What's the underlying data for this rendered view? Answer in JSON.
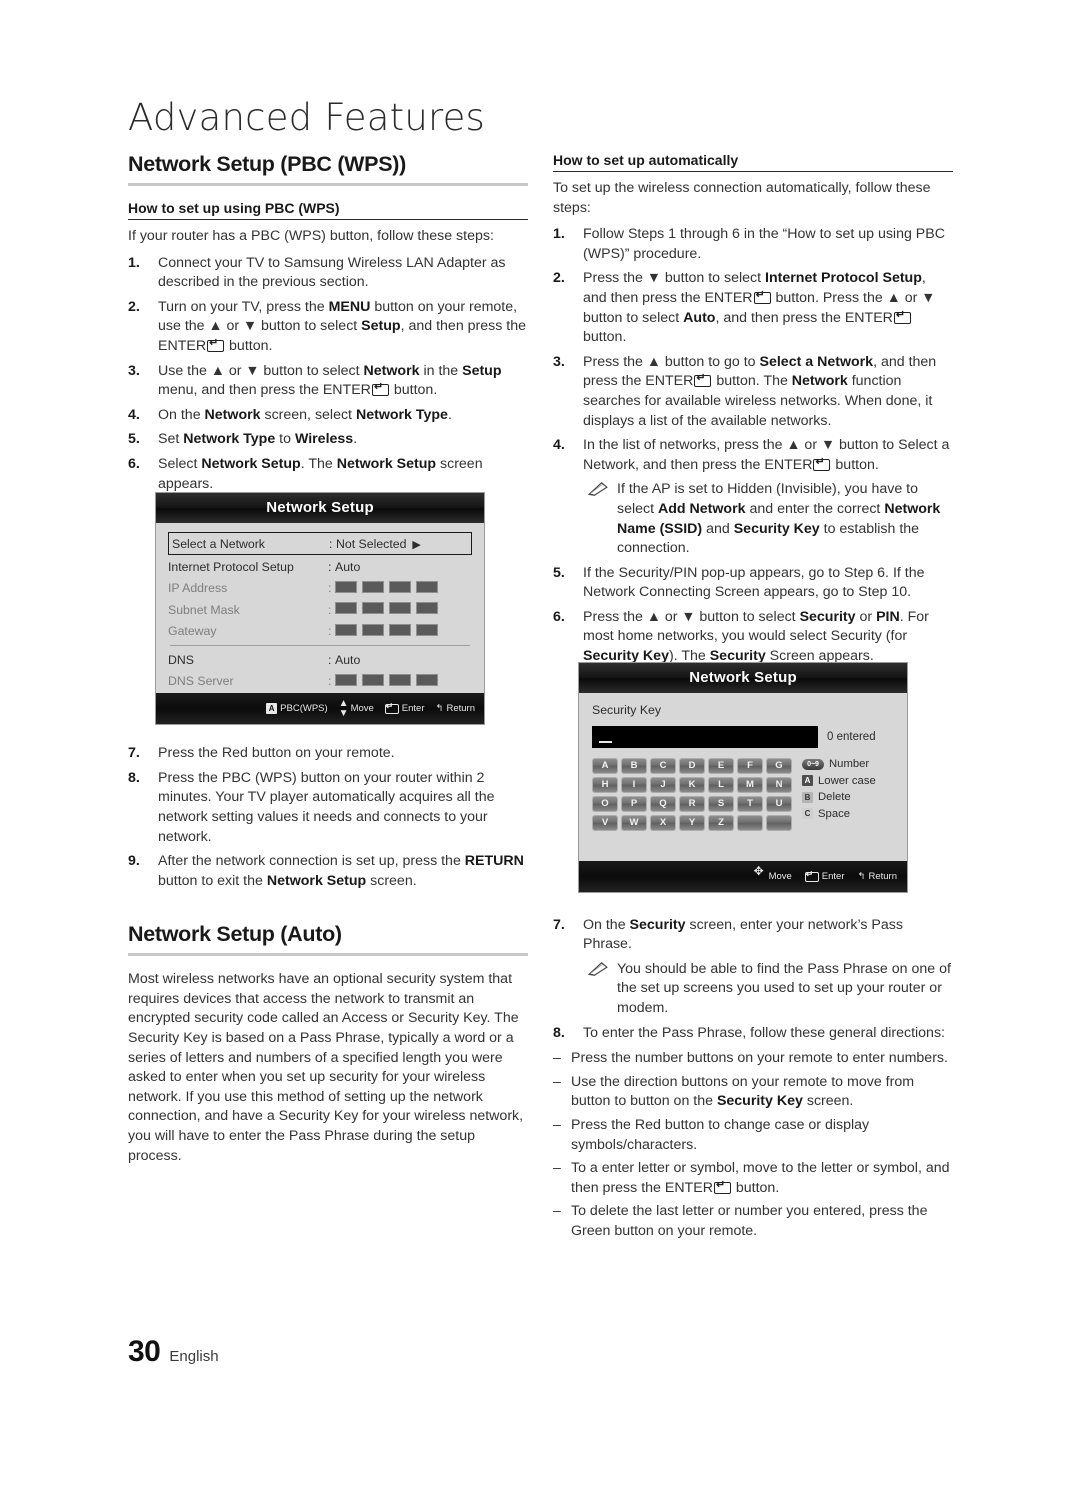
{
  "chapter": {
    "title": "Advanced Features"
  },
  "footer": {
    "page_number": "30",
    "language": "English"
  },
  "left": {
    "section_heading": "Network Setup (PBC (WPS))",
    "sub_heading": "How to set up using PBC (WPS)",
    "intro": "If your router has a PBC (WPS) button, follow these steps:",
    "steps": [
      {
        "num": "1.",
        "text_html": "Connect your TV to Samsung Wireless LAN Adapter as described in the previous section."
      },
      {
        "num": "2.",
        "text_html": "Turn on your TV, press the <b>MENU</b> button on your remote, use the ▲ or ▼ button to select <b>Setup</b>, and then press the ENTER<span class=\"kbd-enter\"></span> button."
      },
      {
        "num": "3.",
        "text_html": "Use the ▲ or ▼ button to select <b>Network</b> in the <b>Setup</b> menu, and then press the ENTER<span class=\"kbd-enter\"></span> button."
      },
      {
        "num": "4.",
        "text_html": "On the <b>Network</b> screen, select <b>Network Type</b>."
      },
      {
        "num": "5.",
        "text_html": "Set <b>Network Type</b> to <b>Wireless</b>."
      },
      {
        "num": "6.",
        "text_html": "Select <b>Network Setup</b>. The <b>Network Setup</b> screen appears."
      }
    ],
    "steps_after": [
      {
        "num": "7.",
        "text_html": "Press the Red button on your remote."
      },
      {
        "num": "8.",
        "text_html": "Press the PBC (WPS) button on your router within 2 minutes. Your TV player automatically acquires all the network setting values it needs and connects to your network."
      },
      {
        "num": "9.",
        "text_html": "After the network connection is set up, press the <b>RETURN</b> button to exit the <b>Network Setup</b> screen."
      }
    ],
    "section_heading2": "Network Setup (Auto)",
    "paragraph2": "Most wireless networks have an optional security system that requires devices that access the network to transmit an encrypted security code called an Access or Security Key. The Security Key is based on a Pass Phrase, typically a word or a series of letters and numbers of a specified length you were asked to enter when you set up security for your wireless network.  If you use this method of setting up the network connection, and have a Security Key for your wireless network, you will have to enter the Pass Phrase during the setup process."
  },
  "right": {
    "sub_heading": "How to set up automatically",
    "intro": "To set up the wireless connection automatically, follow these steps:",
    "steps": [
      {
        "num": "1.",
        "text_html": "Follow Steps 1 through 6 in the “How to set up using PBC (WPS)” procedure."
      },
      {
        "num": "2.",
        "text_html": "Press the ▼ button to select <b>Internet Protocol Setup</b>, and then press the ENTER<span class=\"kbd-enter\"></span> button. Press the ▲ or ▼ button to select <b>Auto</b>, and then press the ENTER<span class=\"kbd-enter\"></span> button."
      },
      {
        "num": "3.",
        "text_html": "Press the ▲ button to go to <b>Select a Network</b>, and then press the ENTER<span class=\"kbd-enter\"></span> button. The <b>Network</b> function searches for available wireless networks. When done, it displays a list of the available networks."
      },
      {
        "num": "4.",
        "text_html": "In the list of networks, press the ▲ or ▼ button to Select a Network, and then press the ENTER<span class=\"kbd-enter\"></span> button.",
        "note_html": "If the AP is set to Hidden (Invisible), you have to select <b>Add Network</b> and enter the correct <b>Network Name (SSID)</b> and <b>Security Key</b> to establish the connection."
      },
      {
        "num": "5.",
        "text_html": "If the Security/PIN pop-up appears, go to Step 6. If the Network Connecting Screen appears, go to Step 10."
      },
      {
        "num": "6.",
        "text_html": "Press the ▲ or ▼ button to select <b>Security</b> or <b>PIN</b>. For most home networks, you would select Security (for <b>Security Key</b>). The <b>Security</b> Screen appears."
      }
    ],
    "steps_after": [
      {
        "num": "7.",
        "text_html": "On the <b>Security</b> screen, enter your network’s Pass Phrase.",
        "note_html": "You should be able to find the Pass Phrase on one of the set up screens you used to set up your router or modem."
      },
      {
        "num": "8.",
        "text_html": "To enter the Pass Phrase, follow these general directions:"
      }
    ],
    "bullets": [
      {
        "mark": "–",
        "text_html": "Press the number buttons on your remote to enter numbers."
      },
      {
        "mark": "–",
        "text_html": "Use the direction buttons on your remote to move from button to button on the <b>Security Key</b> screen."
      },
      {
        "mark": "–",
        "text_html": "Press the Red button to change case or display symbols/characters."
      },
      {
        "mark": "–",
        "text_html": "To a enter letter or symbol, move to the letter or symbol, and then press the ENTER<span class=\"kbd-enter\"></span> button."
      },
      {
        "mark": "–",
        "text_html": "To delete the last letter or number you entered, press the Green button on your remote."
      }
    ]
  },
  "tv_screen_1": {
    "title": "Network Setup",
    "rows": [
      {
        "label": "Select a Network",
        "colon": ":",
        "value": "Not Selected",
        "arrow": "▶",
        "selected": true,
        "dim": false,
        "type": "text"
      },
      {
        "label": "Internet Protocol Setup",
        "colon": ":",
        "value": "Auto",
        "selected": false,
        "dim": false,
        "type": "text"
      },
      {
        "label": "IP Address",
        "colon": ":",
        "value": "",
        "selected": false,
        "dim": true,
        "type": "blocks",
        "blocks": 4
      },
      {
        "label": "Subnet Mask",
        "colon": ":",
        "value": "",
        "selected": false,
        "dim": true,
        "type": "blocks",
        "blocks": 4
      },
      {
        "label": "Gateway",
        "colon": ":",
        "value": "",
        "selected": false,
        "dim": true,
        "type": "blocks",
        "blocks": 4
      },
      {
        "label": "DNS",
        "colon": ":",
        "value": "Auto",
        "selected": false,
        "dim": false,
        "type": "text",
        "divider_before": true
      },
      {
        "label": "DNS Server",
        "colon": ":",
        "value": "",
        "selected": false,
        "dim": true,
        "type": "blocks",
        "blocks": 4
      }
    ],
    "footer": [
      {
        "icon": "red-button-a-icon",
        "badge": "A",
        "label": "PBC(WPS)"
      },
      {
        "icon": "up-down-arrows-icon",
        "badge": "⬍",
        "label": "Move"
      },
      {
        "icon": "enter-key-icon",
        "badge": "",
        "label": "Enter"
      },
      {
        "icon": "return-arrow-icon",
        "badge": "↩",
        "label": "Return"
      }
    ]
  },
  "tv_screen_2": {
    "title": "Network Setup",
    "field_label": "Security Key",
    "input_value": "",
    "entered_count": "0 entered",
    "keys": [
      "A",
      "B",
      "C",
      "D",
      "E",
      "F",
      "G",
      "H",
      "I",
      "J",
      "K",
      "L",
      "M",
      "N",
      "O",
      "P",
      "Q",
      "R",
      "S",
      "T",
      "U",
      "V",
      "W",
      "X",
      "Y",
      "Z",
      "",
      ""
    ],
    "legend": [
      {
        "badge": "0~9",
        "type": "pill",
        "label": "Number"
      },
      {
        "badge": "A",
        "type": "a",
        "label": "Lower case"
      },
      {
        "badge": "B",
        "type": "b",
        "label": "Delete"
      },
      {
        "badge": "C",
        "type": "c",
        "label": "Space"
      }
    ],
    "footer": [
      {
        "icon": "direction-pad-icon",
        "label": "Move"
      },
      {
        "icon": "enter-key-icon",
        "label": "Enter"
      },
      {
        "icon": "return-arrow-icon",
        "label": "Return"
      }
    ]
  }
}
